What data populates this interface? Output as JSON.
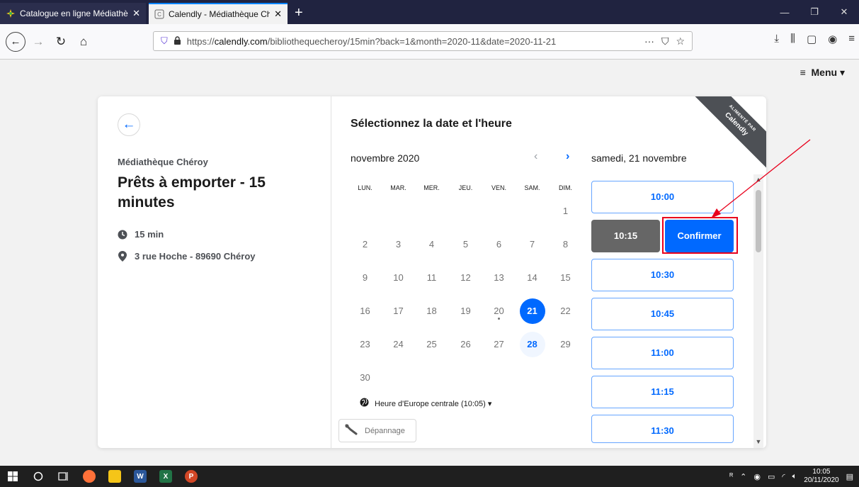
{
  "browser": {
    "tabs": [
      {
        "title": "Catalogue en ligne Médiathèqu",
        "close": "✕"
      },
      {
        "title": "Calendly - Médiathèque Chéroy",
        "close": "✕"
      }
    ],
    "new_tab": "+",
    "url_prefix": "https://",
    "url_domain": "calendly.com",
    "url_path": "/bibliothequecheroy/15min?back=1&month=2020-11&date=2020-11-21",
    "url_actions": [
      "···",
      "☆"
    ]
  },
  "page": {
    "menu_label": "Menu"
  },
  "event": {
    "organizer": "Médiathèque Chéroy",
    "title": "Prêts à emporter - 15 minutes",
    "duration": "15 min",
    "location": "3 rue Hoche - 89690 Chéroy"
  },
  "calendar": {
    "heading": "Sélectionnez la date et l'heure",
    "month": "novembre 2020",
    "weekdays": [
      "LUN.",
      "MAR.",
      "MER.",
      "JEU.",
      "VEN.",
      "SAM.",
      "DIM."
    ],
    "first_weekday_index": 6,
    "days_in_month": 30,
    "available_days": [
      21,
      28
    ],
    "selected_day": 21,
    "today": 20,
    "timezone": "Heure d'Europe centrale (10:05) ▾",
    "troubleshoot": "Dépannage"
  },
  "slots": {
    "date_label": "samedi, 21 novembre",
    "times": [
      "10:00",
      "10:15",
      "10:30",
      "10:45",
      "11:00",
      "11:15",
      "11:30"
    ],
    "selected": "10:15",
    "confirm_label": "Confirmer"
  },
  "ribbon": {
    "small": "ALIMENTÉ PAR",
    "brand": "Calendly"
  },
  "taskbar": {
    "time": "10:05",
    "date": "20/11/2020"
  },
  "colors": {
    "accent": "#0069ff",
    "selected_slot": "#666666",
    "annotation": "#e8001c"
  }
}
